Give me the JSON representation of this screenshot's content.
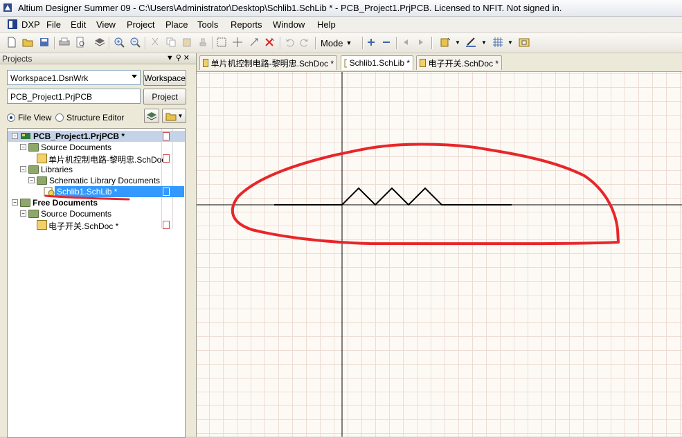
{
  "window": {
    "title": "Altium Designer Summer 09 - C:\\Users\\Administrator\\Desktop\\Schlib1.SchLib * - PCB_Project1.PrjPCB. Licensed to NFIT. Not signed in."
  },
  "menu": [
    {
      "label": "DXP"
    },
    {
      "label": "File"
    },
    {
      "label": "Edit"
    },
    {
      "label": "View"
    },
    {
      "label": "Project"
    },
    {
      "label": "Place"
    },
    {
      "label": "Tools"
    },
    {
      "label": "Reports"
    },
    {
      "label": "Window"
    },
    {
      "label": "Help"
    }
  ],
  "toolbar": {
    "mode_label": "Mode"
  },
  "panel": {
    "title": "Projects",
    "workspace_value": "Workspace1.DsnWrk",
    "workspace_button": "Workspace",
    "project_value": "PCB_Project1.PrjPCB",
    "project_button": "Project",
    "view_options": [
      "File View",
      "Structure Editor"
    ],
    "selected_view": "File View"
  },
  "tree": [
    {
      "label": "PCB_Project1.PrjPCB *",
      "level": 0
    },
    {
      "label": "Source Documents",
      "level": 1
    },
    {
      "label": "单片机控制电路-黎明忠.SchDoc",
      "level": 2
    },
    {
      "label": "Libraries",
      "level": 1
    },
    {
      "label": "Schematic Library Documents",
      "level": 2
    },
    {
      "label": "Schlib1.SchLib *",
      "level": 3,
      "selected": true
    },
    {
      "label": "Free Documents",
      "level": 0
    },
    {
      "label": "Source Documents",
      "level": 1
    },
    {
      "label": "电子开关.SchDoc *",
      "level": 2
    }
  ],
  "tabs": [
    {
      "label": "单片机控制电路-黎明忠.SchDoc *"
    },
    {
      "label": "Schlib1.SchLib *",
      "active": true
    },
    {
      "label": "电子开关.SchDoc *"
    }
  ],
  "colors": {
    "selection": "#3399ff",
    "annotation": "#e8262a",
    "grid": "#eddcd4",
    "canvas": "#fdfaf5"
  }
}
